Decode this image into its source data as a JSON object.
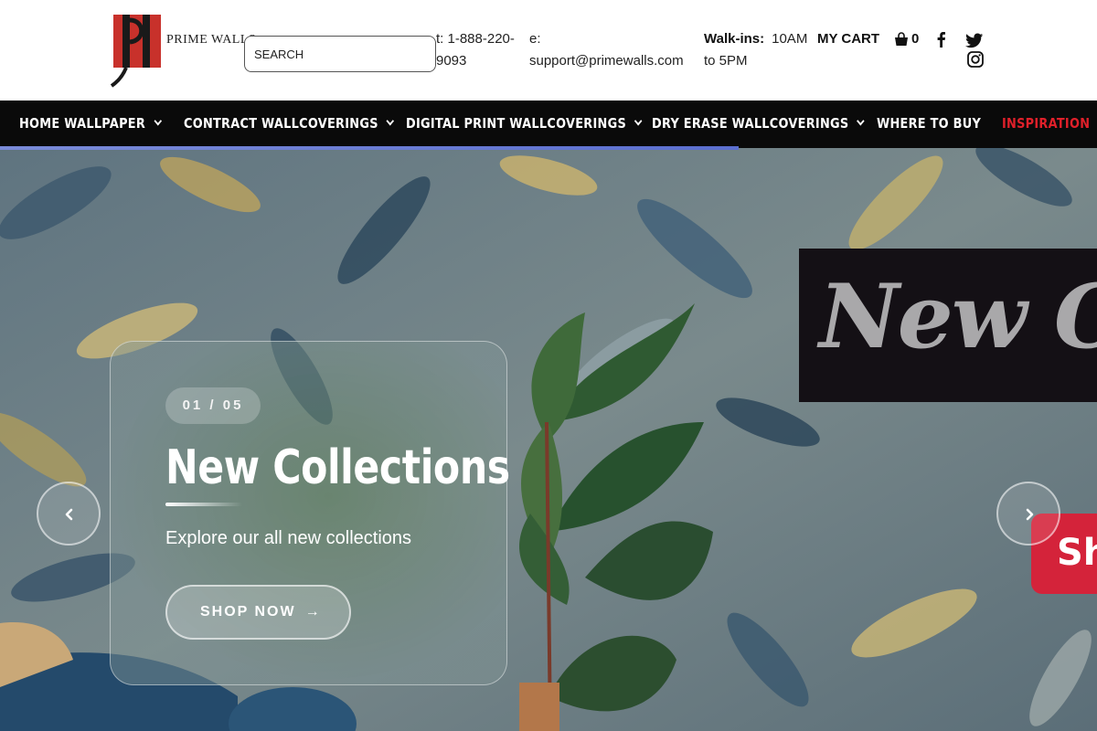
{
  "brand": {
    "name": "PRIME WALLS",
    "accent": "#c8312b"
  },
  "search": {
    "placeholder": "SEARCH"
  },
  "contact": {
    "phone": "t: 1-888-220-9093",
    "email": "e: support@primewalls.com",
    "walkins_label": "Walk-ins:",
    "walkins_hours": "10AM to 5PM"
  },
  "cart": {
    "label": "MY CART",
    "count": "0"
  },
  "social": [
    "facebook-icon",
    "twitter-icon",
    "instagram-icon"
  ],
  "nav": {
    "items": [
      {
        "label": "HOME WALLPAPER",
        "dropdown": true
      },
      {
        "label": "CONTRACT WALLCOVERINGS",
        "dropdown": true
      },
      {
        "label": "DIGITAL PRINT WALLCOVERINGS",
        "dropdown": true
      },
      {
        "label": "DRY ERASE WALLCOVERINGS",
        "dropdown": true
      },
      {
        "label": "WHERE TO BUY",
        "dropdown": false
      },
      {
        "label": "INSPIRATION",
        "dropdown": false,
        "color": "#e0202a"
      }
    ]
  },
  "hero": {
    "counter": "01 / 05",
    "title": "New Collections",
    "subtitle": "Explore our all new collections",
    "cta": "SHOP NOW",
    "cta_arrow": "→",
    "sign_text": "New Co",
    "badge_text": "Sh"
  }
}
